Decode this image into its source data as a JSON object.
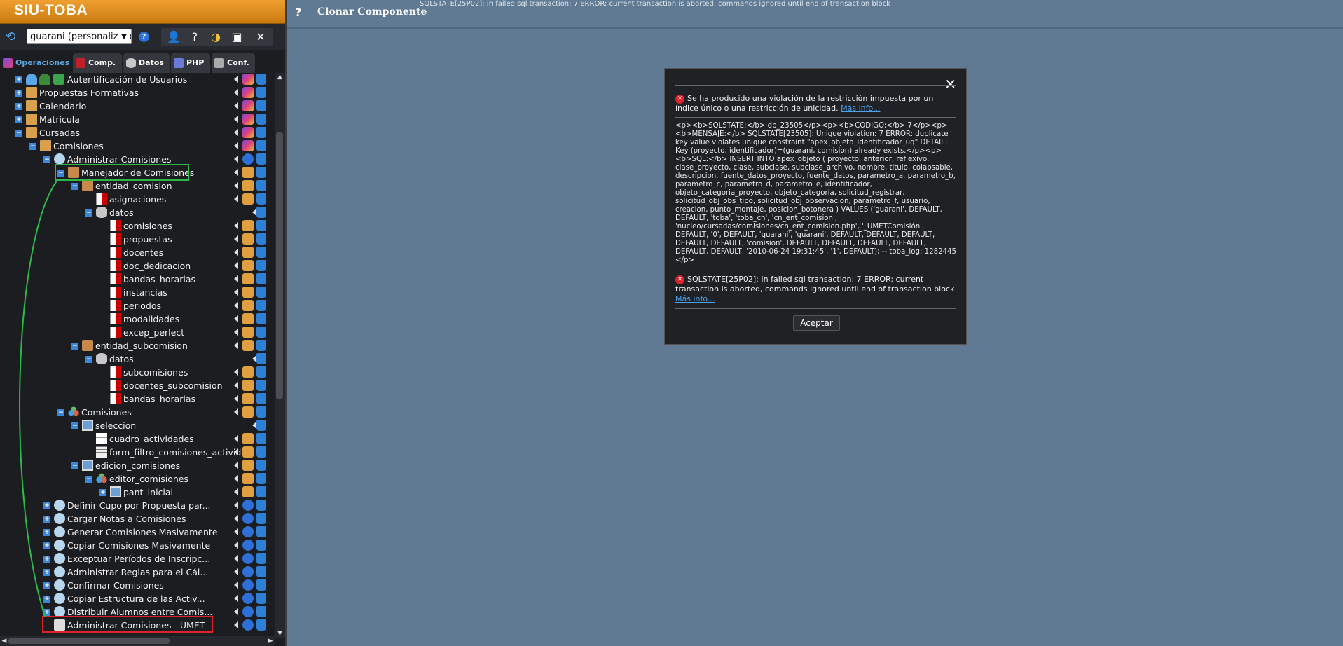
{
  "app": {
    "brand": "SIU-TOBA"
  },
  "toolbar": {
    "project": "guarani (personalizado"
  },
  "tabs": [
    {
      "label": "Operaciones",
      "icon": "operations-icon"
    },
    {
      "label": "Comp.",
      "icon": "components-icon"
    },
    {
      "label": "Datos",
      "icon": "database-icon"
    },
    {
      "label": "PHP",
      "icon": "php-icon"
    },
    {
      "label": "Conf.",
      "icon": "wrench-icon"
    }
  ],
  "tree": {
    "rows": [
      {
        "label": "Autentificación de Usuarios"
      },
      {
        "label": "Propuestas Formativas"
      },
      {
        "label": "Calendario"
      },
      {
        "label": "Matrícula"
      },
      {
        "label": "Cursadas"
      },
      {
        "label": "Comisiones"
      },
      {
        "label": "Administrar Comisiones"
      },
      {
        "label": "Manejador de Comisiones"
      },
      {
        "label": "entidad_comision"
      },
      {
        "label": "asignaciones"
      },
      {
        "label": "datos"
      },
      {
        "label": "comisiones"
      },
      {
        "label": "propuestas"
      },
      {
        "label": "docentes"
      },
      {
        "label": "doc_dedicacion"
      },
      {
        "label": "bandas_horarias"
      },
      {
        "label": "instancias"
      },
      {
        "label": "periodos"
      },
      {
        "label": "modalidades"
      },
      {
        "label": "excep_perlect"
      },
      {
        "label": "entidad_subcomision"
      },
      {
        "label": "datos"
      },
      {
        "label": "subcomisiones"
      },
      {
        "label": "docentes_subcomision"
      },
      {
        "label": "bandas_horarias"
      },
      {
        "label": "Comisiones"
      },
      {
        "label": "seleccion"
      },
      {
        "label": "cuadro_actividades"
      },
      {
        "label": "form_filtro_comisiones_activid..."
      },
      {
        "label": "edicion_comisiones"
      },
      {
        "label": "editor_comisiones"
      },
      {
        "label": "pant_inicial"
      },
      {
        "label": "Definir Cupo por Propuesta par..."
      },
      {
        "label": "Cargar Notas a Comisiones"
      },
      {
        "label": "Generar Comisiones Masivamente"
      },
      {
        "label": "Copiar Comisiones Masivamente"
      },
      {
        "label": "Exceptuar Períodos de Inscripc..."
      },
      {
        "label": "Administrar Reglas para el Cál..."
      },
      {
        "label": "Confirmar Comisiones"
      },
      {
        "label": "Copiar Estructura de las Activ..."
      },
      {
        "label": "Distribuir Alumnos entre Comis..."
      },
      {
        "label": "Administrar Comisiones - UMET"
      }
    ]
  },
  "main": {
    "help_glyph": "?",
    "title": "Clonar Componente",
    "status": "SQLSTATE[25P02]: In failed sql transaction: 7 ERROR: current transaction is aborted, commands ignored until end of transaction block"
  },
  "modal": {
    "error1_text": "Se ha producido una violación de la restricción impuesta por un índice único o una restricción de unicidad.",
    "more_info_1": "Más info...",
    "detail": "<p><b>SQLSTATE:</b> db_23505</p><p><b>CODIGO:</b> 7</p><p><b>MENSAJE:</b> SQLSTATE[23505]: Unique violation: 7 ERROR: duplicate key value violates unique constraint \"apex_objeto_identificador_uq\" DETAIL: Key (proyecto, identificador)=(guarani, comision) already exists.</p><p><b>SQL:</b> INSERT INTO apex_objeto ( proyecto, anterior, reflexivo, clase_proyecto, clase, subclase, subclase_archivo, nombre, titulo, colapsable, descripcion, fuente_datos_proyecto, fuente_datos, parametro_a, parametro_b, parametro_c, parametro_d, parametro_e, identificador, objeto_categoria_proyecto, objeto_categoria, solicitud_registrar, solicitud_obj_obs_tipo, solicitud_obj_observacion, parametro_f, usuario, creacion, punto_montaje, posicion_botonera ) VALUES ('guarani', DEFAULT, DEFAULT, 'toba', 'toba_cn', 'cn_ent_comision', 'nucleo/cursadas/comisiones/cn_ent_comision.php', '_UMETComisión', DEFAULT, '0', DEFAULT, 'guarani', 'guarani', DEFAULT, DEFAULT, DEFAULT, DEFAULT, DEFAULT, 'comision', DEFAULT, DEFAULT, DEFAULT, DEFAULT, DEFAULT, DEFAULT, '2010-06-24 19:31:45', '1', DEFAULT); -- toba_log: 1282445 </p>",
    "error2_text": "SQLSTATE[25P02]: In failed sql transaction: 7 ERROR: current transaction is aborted, commands ignored until end of transaction block",
    "more_info_2": "Más info...",
    "accept_label": "Aceptar"
  },
  "colors": {
    "brand_orange": "#e8931c",
    "sidebar_bg": "#1b1d21",
    "main_bg": "#5f7a92",
    "highlight_green": "#2fb84a",
    "highlight_red": "#e0202a",
    "link": "#4aa3f0"
  }
}
